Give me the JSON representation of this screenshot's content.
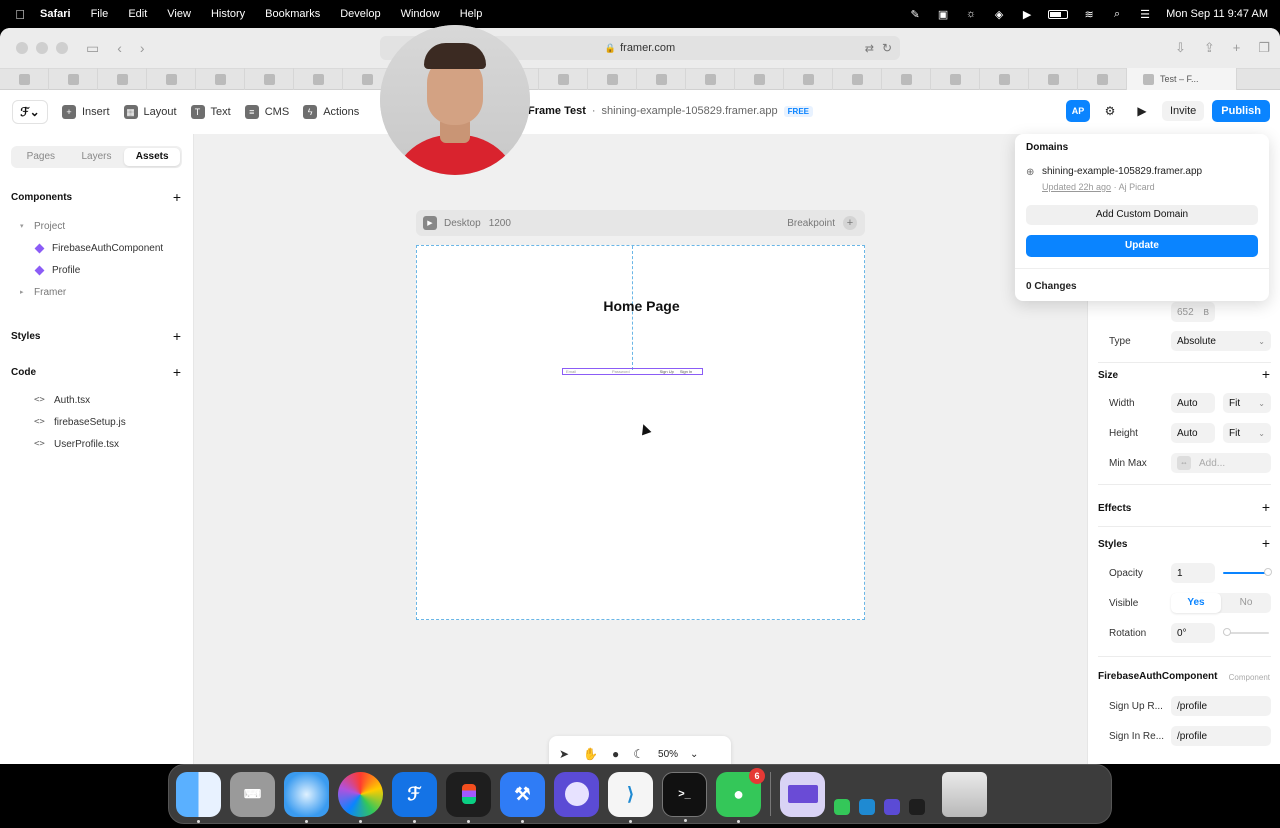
{
  "menubar": {
    "app": "Safari",
    "items": [
      "File",
      "Edit",
      "View",
      "History",
      "Bookmarks",
      "Develop",
      "Window",
      "Help"
    ],
    "clock": "Mon Sep 11  9:47 AM"
  },
  "browser": {
    "url": "framer.com",
    "active_tab": "Test – F..."
  },
  "framer": {
    "tools": [
      "Insert",
      "Layout",
      "Text",
      "CMS",
      "Actions"
    ],
    "project_name": "Frame Test",
    "project_separator": "·",
    "project_domain": "shining-example-105829.framer.app",
    "plan_badge": "FREE",
    "user_initials": "AP",
    "invite_label": "Invite",
    "publish_label": "Publish"
  },
  "left_panel": {
    "tabs": [
      "Pages",
      "Layers",
      "Assets"
    ],
    "active_tab": "Assets",
    "components_heading": "Components",
    "project_folder": "Project",
    "components": [
      "FirebaseAuthComponent",
      "Profile"
    ],
    "framer_folder": "Framer",
    "styles_heading": "Styles",
    "code_heading": "Code",
    "code_files": [
      "Auth.tsx",
      "firebaseSetup.js",
      "UserProfile.tsx"
    ]
  },
  "canvas": {
    "frame_label": "Desktop",
    "frame_width": "1200",
    "breakpoint_label": "Breakpoint",
    "page_heading": "Home Page",
    "auth_fields": [
      "Email",
      "Password",
      "Sign Up",
      "Sign In"
    ],
    "zoom": "50%"
  },
  "domains_popover": {
    "title": "Domains",
    "domain": "shining-example-105829.framer.app",
    "updated_ago": "Updated 22h ago",
    "updated_by": "· Aj Picard",
    "add_custom_label": "Add Custom Domain",
    "update_label": "Update",
    "changes": "0 Changes"
  },
  "right_panel": {
    "position_value": "652",
    "position_unit": "B",
    "type_label": "Type",
    "type_value": "Absolute",
    "size_heading": "Size",
    "width_label": "Width",
    "width_value": "Auto",
    "width_mode": "Fit",
    "height_label": "Height",
    "height_value": "Auto",
    "height_mode": "Fit",
    "minmax_label": "Min Max",
    "minmax_placeholder": "Add...",
    "effects_heading": "Effects",
    "styles_heading": "Styles",
    "opacity_label": "Opacity",
    "opacity_value": "1",
    "visible_label": "Visible",
    "visible_yes": "Yes",
    "visible_no": "No",
    "rotation_label": "Rotation",
    "rotation_value": "0°",
    "component_heading": "FirebaseAuthComponent",
    "component_tag": "Component",
    "signup_label": "Sign Up R...",
    "signup_value": "/profile",
    "signin_label": "Sign In Re...",
    "signin_value": "/profile"
  },
  "dock": {
    "messages_badge": "6"
  },
  "colors": {
    "accent": "#0a84ff",
    "component": "#8b5cf6",
    "guide": "#6ab6e6"
  }
}
